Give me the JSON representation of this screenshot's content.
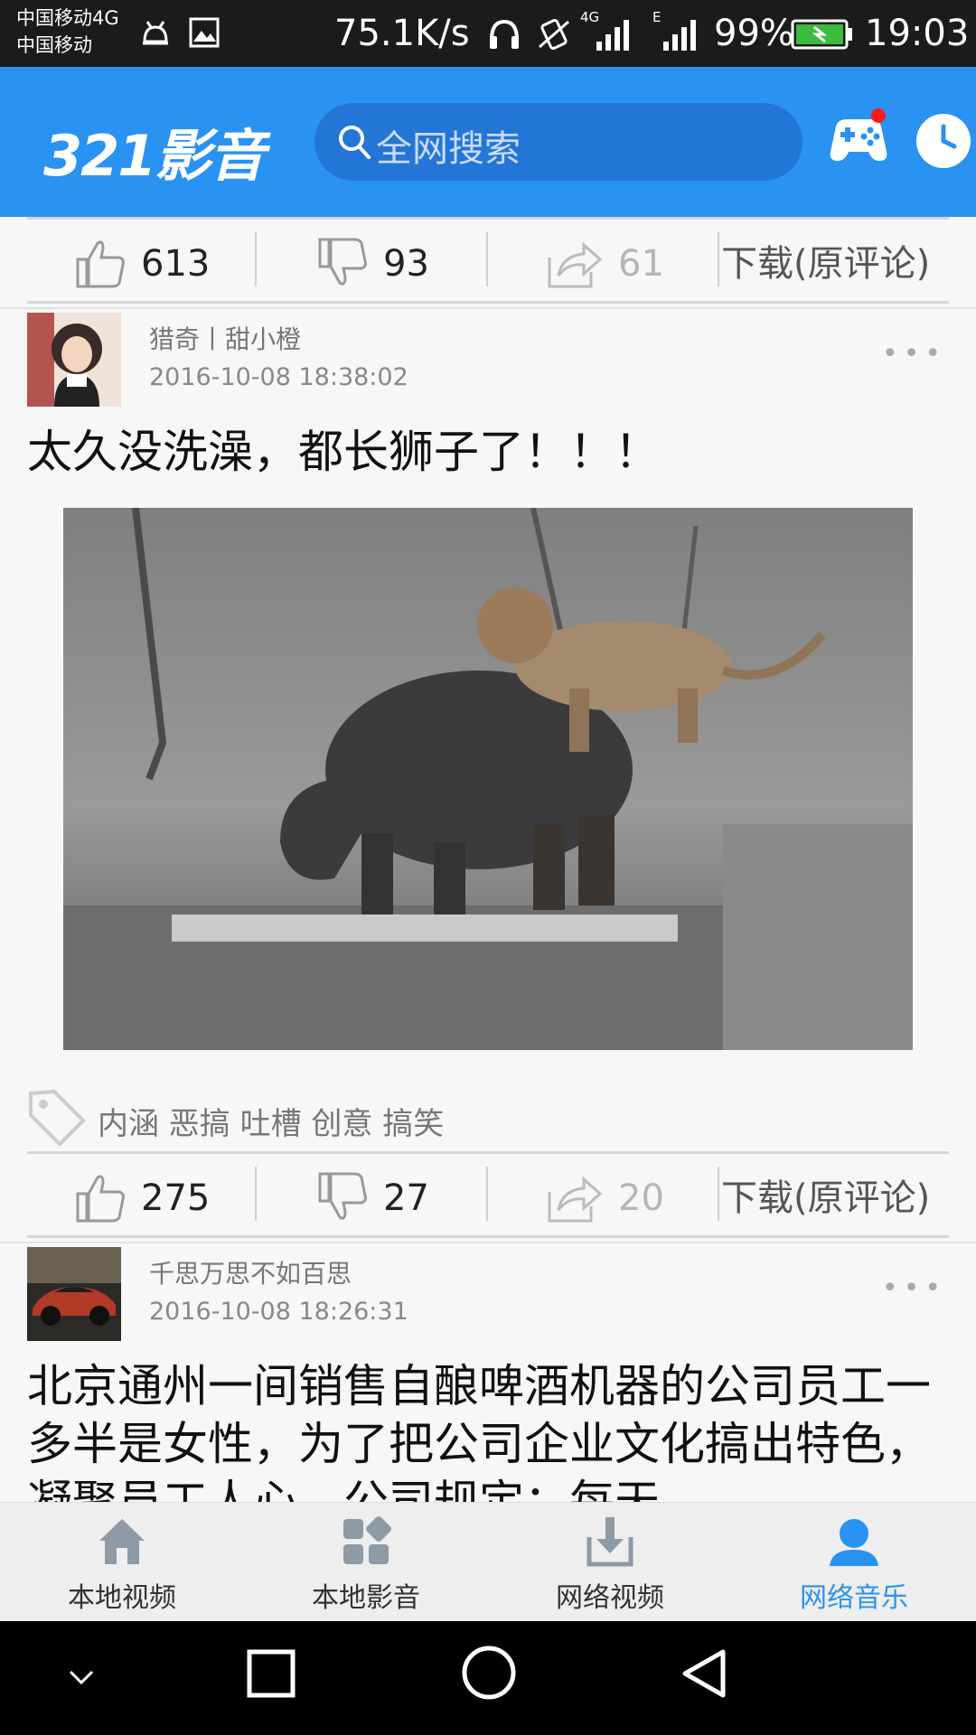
{
  "status_bar": {
    "carrier_line1": "中国移动4G",
    "carrier_line2": "中国移动",
    "net_speed": "75.1K/s",
    "signal1_tag": "4G",
    "signal2_tag": "E",
    "battery": "99%",
    "time": "19:03",
    "icons": [
      "android-icon",
      "image-icon",
      "headphones-icon",
      "vibrate-icon",
      "signal-icon",
      "battery-icon"
    ]
  },
  "header": {
    "logo": "321影音",
    "search_placeholder": "全网搜索",
    "icons": [
      "search-icon",
      "gamepad-icon",
      "clock-icon"
    ],
    "accent_color": "#2a92f1",
    "notification_dot_color": "#ff1a1a"
  },
  "top_actions": {
    "likes": "613",
    "dislikes": "93",
    "shares": "61",
    "download_label": "下载(原评论)"
  },
  "posts": [
    {
      "author": "猎奇丨甜小橙",
      "date": "2016-10-08 18:38:02",
      "title": "太久没洗澡，都长狮子了！！！",
      "more": "•••",
      "tags": "内涵 恶搞 吐槽 创意 搞笑",
      "likes": "275",
      "dislikes": "27",
      "shares": "20",
      "download_label": "下载(原评论)"
    },
    {
      "author": "千思万思不如百思",
      "date": "2016-10-08 18:26:31",
      "title": "北京通州一间销售自酿啤酒机器的公司员工一多半是女性，为了把公司企业文化搞出特色，凝聚员工人心，公司规定：每天",
      "more": "•••"
    }
  ],
  "tabs": [
    {
      "label": "本地视频",
      "icon": "home-icon",
      "active": false
    },
    {
      "label": "本地影音",
      "icon": "grid-icon",
      "active": false
    },
    {
      "label": "网络视频",
      "icon": "download-icon",
      "active": false
    },
    {
      "label": "网络音乐",
      "icon": "user-icon",
      "active": true
    }
  ],
  "system_nav": [
    "collapse-chevron-icon",
    "recents-square-icon",
    "home-circle-icon",
    "back-triangle-icon"
  ]
}
